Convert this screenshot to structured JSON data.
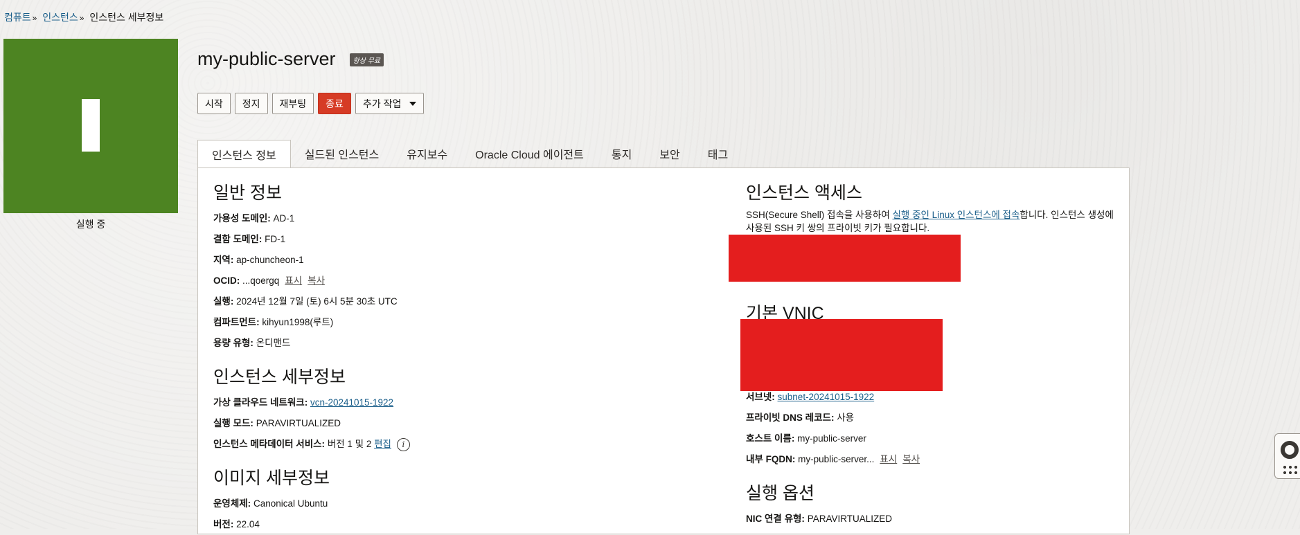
{
  "breadcrumb": {
    "compute": "컴퓨트",
    "instances": "인스턴스",
    "current": "인스턴스 세부정보",
    "sep": "»"
  },
  "status": {
    "label": "실행 중",
    "color": "#4d8422"
  },
  "header": {
    "title": "my-public-server",
    "badge": "항상 무료"
  },
  "actions": {
    "start": "시작",
    "stop": "정지",
    "reboot": "재부팅",
    "terminate": "종료",
    "more": "추가 작업"
  },
  "tabs": [
    "인스턴스 정보",
    "실드된 인스턴스",
    "유지보수",
    "Oracle Cloud 에이전트",
    "통지",
    "보안",
    "태그"
  ],
  "general": {
    "title": "일반 정보",
    "availability_domain": {
      "label": "가용성 도메인:",
      "value": "AD-1"
    },
    "fault_domain": {
      "label": "결함 도메인:",
      "value": "FD-1"
    },
    "region": {
      "label": "지역:",
      "value": "ap-chuncheon-1"
    },
    "ocid": {
      "label": "OCID:",
      "value": "...qoergq",
      "show": "표시",
      "copy": "복사"
    },
    "launched": {
      "label": "실행:",
      "value": "2024년 12월 7일 (토) 6시 5분 30초 UTC"
    },
    "compartment": {
      "label": "컴파트먼트:",
      "value": "kihyun1998(루트)"
    },
    "capacity_type": {
      "label": "용량 유형:",
      "value": "온디맨드"
    }
  },
  "instance_details": {
    "title": "인스턴스 세부정보",
    "vcn": {
      "label": "가상 클라우드 네트워크:",
      "value": "vcn-20241015-1922"
    },
    "launch_mode": {
      "label": "실행 모드:",
      "value": "PARAVIRTUALIZED"
    },
    "metadata_service": {
      "label": "인스턴스 메타데이터 서비스:",
      "value": "버전 1 및 2",
      "edit": "편집"
    }
  },
  "image_details": {
    "title": "이미지 세부정보",
    "os": {
      "label": "운영체제:",
      "value": "Canonical Ubuntu"
    },
    "version": {
      "label": "버전:",
      "value": "22.04"
    }
  },
  "instance_access": {
    "title": "인스턴스 액세스",
    "text_before": "SSH(Secure Shell) 접속을 사용하여 ",
    "link": "실행 중인 Linux 인스턴스에 접속",
    "text_after": "합니다. 인스턴스 생성에 사용된 SSH 키 쌍의 프라이빗 키가 필요합니다."
  },
  "primary_vnic": {
    "title": "기본 VNIC",
    "subnet": {
      "label": "서브넷:",
      "value": "subnet-20241015-1922"
    },
    "private_dns": {
      "label": "프라이빗 DNS 레코드:",
      "value": "사용"
    },
    "hostname": {
      "label": "호스트 이름:",
      "value": "my-public-server"
    },
    "internal_fqdn": {
      "label": "내부 FQDN:",
      "value": "my-public-server...",
      "show": "표시",
      "copy": "복사"
    }
  },
  "launch_options": {
    "title": "실행 옵션",
    "nic_attachment": {
      "label": "NIC 연결 유형:",
      "value": "PARAVIRTUALIZED"
    }
  },
  "colors": {
    "accent_link": "#1a5e8a",
    "danger": "#d63b25",
    "redaction": "#e41e1e"
  },
  "icons": [
    "info-icon",
    "lifebuoy-icon",
    "grid-icon",
    "caret-down-icon"
  ]
}
